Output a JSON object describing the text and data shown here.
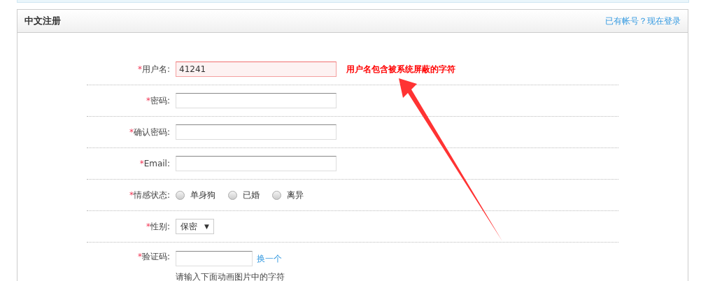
{
  "panel": {
    "title": "中文注册",
    "login_link": "已有帐号？现在登录"
  },
  "fields": [
    {
      "kind": "text",
      "required_mark": "*",
      "label": "用户名:",
      "value": "41241",
      "error": true,
      "message": "用户名包含被系统屏蔽的字符"
    },
    {
      "kind": "text",
      "required_mark": "*",
      "label": "密码:",
      "error": false
    },
    {
      "kind": "text",
      "required_mark": "*",
      "label": "确认密码:",
      "error": false
    },
    {
      "kind": "text",
      "required_mark": "*",
      "label": "Email:",
      "error": false
    },
    {
      "kind": "radio",
      "required_mark": "*",
      "label": "情感状态:",
      "options": [
        {
          "label": "单身狗",
          "selected": false
        },
        {
          "label": "已婚",
          "selected": false
        },
        {
          "label": "离异",
          "selected": false
        }
      ]
    },
    {
      "kind": "select",
      "required_mark": "*",
      "label": "性别:",
      "value": "保密",
      "caret": "▼"
    },
    {
      "kind": "captcha",
      "required_mark": "*",
      "label": "验证码:",
      "link": "换一个",
      "hint": "请输入下面动画图片中的字符"
    }
  ]
}
